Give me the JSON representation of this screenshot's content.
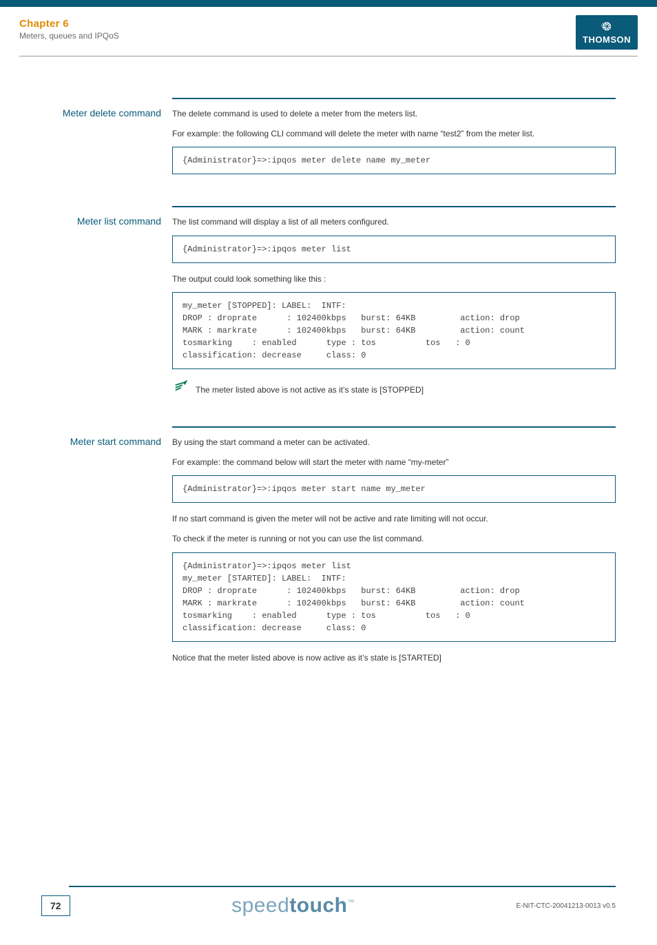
{
  "header": {
    "chapter": "Chapter 6",
    "subchapter": "Meters, queues and IPQoS",
    "brand": "THOMSON"
  },
  "sections": {
    "delete": {
      "label": "Meter delete command",
      "p1": "The delete command is used to delete a meter from the meters list.",
      "p2": "For example: the following CLI command will delete the meter with name “test2” from the meter list.",
      "code1": "{Administrator}=>:ipqos meter delete name my_meter"
    },
    "list": {
      "label": "Meter list command",
      "p1": "The list command will display a list of all meters configured.",
      "code1": "{Administrator}=>:ipqos meter list",
      "p2": "The output could look something like this :",
      "code2": "my_meter [STOPPED]: LABEL:  INTF:\nDROP : droprate      : 102400kbps   burst: 64KB         action: drop\nMARK : markrate      : 102400kbps   burst: 64KB         action: count\ntosmarking    : enabled      type : tos          tos   : 0\nclassification: decrease     class: 0",
      "note": "The meter listed above is not active as it’s state is [STOPPED]"
    },
    "start": {
      "label": "Meter start command",
      "p1": "By using the start command a meter can be activated.",
      "p2": "For example: the command below will start the meter with name “my-meter”",
      "code1": "{Administrator}=>:ipqos meter start name my_meter",
      "p3": "If no start command is given the meter will not be active and rate limiting will not occur.",
      "p4": "To check if the meter is running or not you can use the list command.",
      "code2": "{Administrator}=>:ipqos meter list\nmy_meter [STARTED]: LABEL:  INTF:\nDROP : droprate      : 102400kbps   burst: 64KB         action: drop\nMARK : markrate      : 102400kbps   burst: 64KB         action: count\ntosmarking    : enabled      type : tos          tos   : 0\nclassification: decrease     class: 0",
      "p5": "Notice that the meter listed above is now active as it’s state is [STARTED]"
    }
  },
  "footer": {
    "page": "72",
    "product_a": "speed",
    "product_b": "touch",
    "tm": "™",
    "docid": "E-NIT-CTC-20041213-0013 v0.5"
  }
}
